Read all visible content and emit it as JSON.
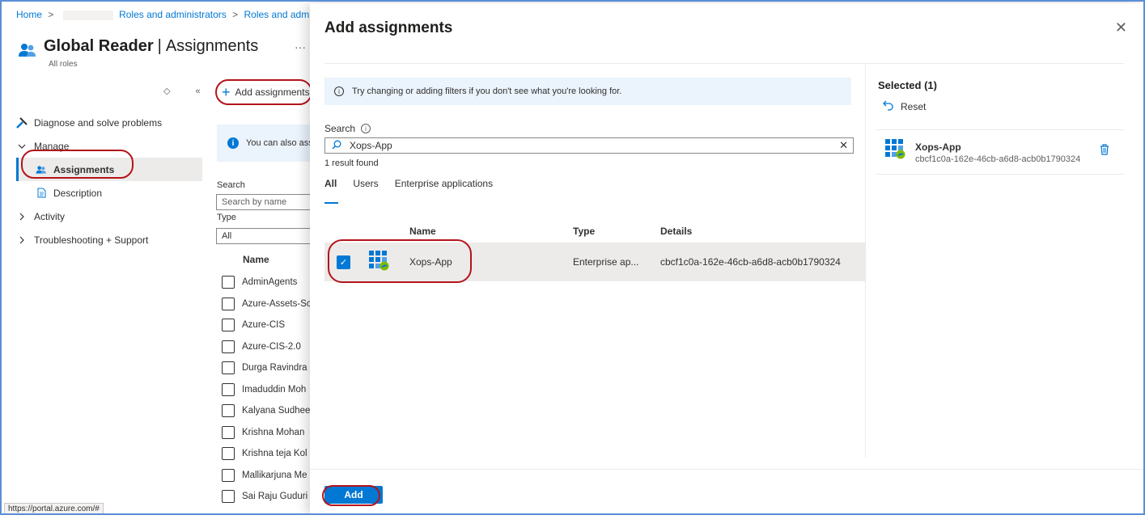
{
  "breadcrumb": {
    "home": "Home",
    "separator": ">",
    "roles_admins": "Roles and administrators",
    "roles_and_adm": "Roles and adm"
  },
  "page": {
    "title_bold": "Global Reader",
    "title_sep": "|",
    "title_rest": "Assignments",
    "more": "···",
    "subtitle": "All roles"
  },
  "nav": {
    "collapse_ctrl": "◇ «",
    "items": [
      {
        "label": "Diagnose and solve problems",
        "icon": "wrench-icon"
      },
      {
        "label": "Manage",
        "icon": "chevron-down-icon"
      },
      {
        "label": "Assignments",
        "icon": "people-icon",
        "selected": true
      },
      {
        "label": "Description",
        "icon": "document-icon"
      },
      {
        "label": "Activity",
        "icon": "chevron-right-icon"
      },
      {
        "label": "Troubleshooting + Support",
        "icon": "chevron-right-icon"
      }
    ]
  },
  "toolbar": {
    "add_assignments": "Add assignments"
  },
  "banner": {
    "text": "You can also assign"
  },
  "filters": {
    "search_label": "Search",
    "search_placeholder": "Search by name",
    "type_label": "Type",
    "type_value": "All"
  },
  "bg_list": {
    "name_header": "Name",
    "rows": [
      "AdminAgents",
      "Azure-Assets-Sc",
      "Azure-CIS",
      "Azure-CIS-2.0",
      "Durga Ravindra",
      "Imaduddin Moh",
      "Kalyana Sudhee",
      "Krishna Mohan",
      "Krishna teja Kol",
      "Mallikarjuna Me",
      "Sai Raju Guduri"
    ]
  },
  "status_bar": {
    "url": "https://portal.azure.com/#"
  },
  "blade": {
    "title": "Add assignments",
    "close": "✕",
    "hint": "Try changing or adding filters if you don't see what you're looking for.",
    "search_label": "Search",
    "search_value": "Xops-App",
    "result_count": "1 result found",
    "tabs": [
      "All",
      "Users",
      "Enterprise applications"
    ],
    "columns": {
      "name": "Name",
      "type": "Type",
      "details": "Details"
    },
    "results": [
      {
        "name": "Xops-App",
        "type": "Enterprise ap...",
        "details": "cbcf1c0a-162e-46cb-a6d8-acb0b1790324",
        "checked": true
      }
    ],
    "selected": {
      "title": "Selected (1)",
      "reset": "Reset",
      "items": [
        {
          "name": "Xops-App",
          "id": "cbcf1c0a-162e-46cb-a6d8-acb0b1790324"
        }
      ]
    },
    "add_button": "Add"
  },
  "colors": {
    "accent": "#0078d4",
    "annotation": "#b4141a",
    "frame": "#5b8fd6",
    "info_bg": "#ebf3fc",
    "selected_row": "#edebe9"
  }
}
